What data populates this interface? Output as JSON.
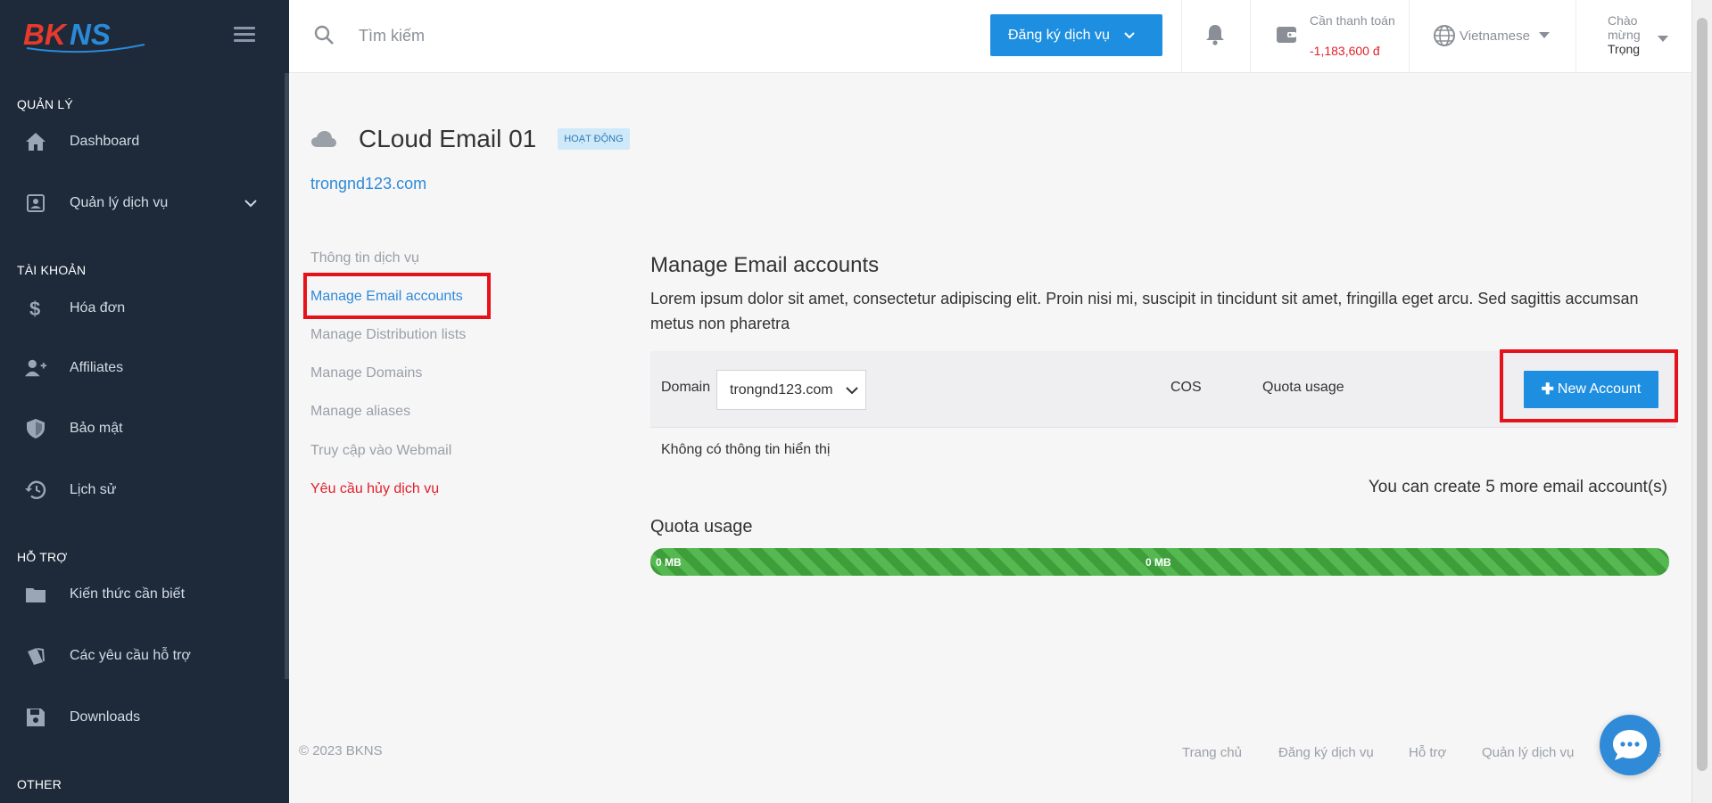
{
  "sidebar": {
    "logo_text": "BKNS",
    "sections": {
      "manage": "QUẢN LÝ",
      "account": "TÀI KHOẢN",
      "support": "HỖ TRỢ",
      "other": "OTHER"
    },
    "items": {
      "dashboard": "Dashboard",
      "services": "Quản lý dịch vụ",
      "invoices": "Hóa đơn",
      "affiliates": "Affiliates",
      "security": "Bảo mật",
      "history": "Lịch sử",
      "knowledge": "Kiến thức cần biết",
      "tickets": "Các yêu cầu hỗ trợ",
      "downloads": "Downloads"
    }
  },
  "topbar": {
    "search_placeholder": "Tìm kiếm",
    "register_label": "Đăng ký dịch vụ",
    "payment_label": "Cần thanh toán",
    "payment_amount": "-1,183,600 đ",
    "language": "Vietnamese",
    "greeting": "Chào mừng",
    "user_name": "Trọng"
  },
  "service": {
    "title": "CLoud Email 01",
    "status": "HOẠT ĐỘNG",
    "domain": "trongnd123.com"
  },
  "subnav": {
    "info": "Thông tin dịch vụ",
    "manage_email": "Manage Email accounts",
    "distribution": "Manage Distribution lists",
    "domains": "Manage Domains",
    "aliases": "Manage aliases",
    "webmail": "Truy cập vào Webmail",
    "cancel": "Yêu cầu hủy dịch vụ"
  },
  "main": {
    "title": "Manage Email accounts",
    "description": "Lorem ipsum dolor sit amet, consectetur adipiscing elit. Proin nisi mi, suscipit in tincidunt sit amet, fringilla eget arcu. Sed sagittis accumsan metus non pharetra",
    "domain_label": "Domain",
    "domain_value": "trongnd123.com",
    "cos_label": "COS",
    "quota_label": "Quota usage",
    "new_account_label": "New Account",
    "empty_text": "Không có thông tin hiển thị",
    "more_text": "You can create 5 more email account(s)",
    "quota_title": "Quota usage",
    "quota_used": "0 MB",
    "quota_total": "0 MB"
  },
  "footer": {
    "copyright": "© 2023 BKNS",
    "links": [
      "Trang chủ",
      "Đăng ký dịch vụ",
      "Hỗ trợ",
      "Quản lý dịch vụ",
      "s"
    ]
  },
  "colors": {
    "sidebar_bg": "#1e2a3a",
    "accent": "#1e8fe0",
    "danger": "#e0202a",
    "highlight": "#e6121a",
    "progress": "#3d9e3a"
  }
}
